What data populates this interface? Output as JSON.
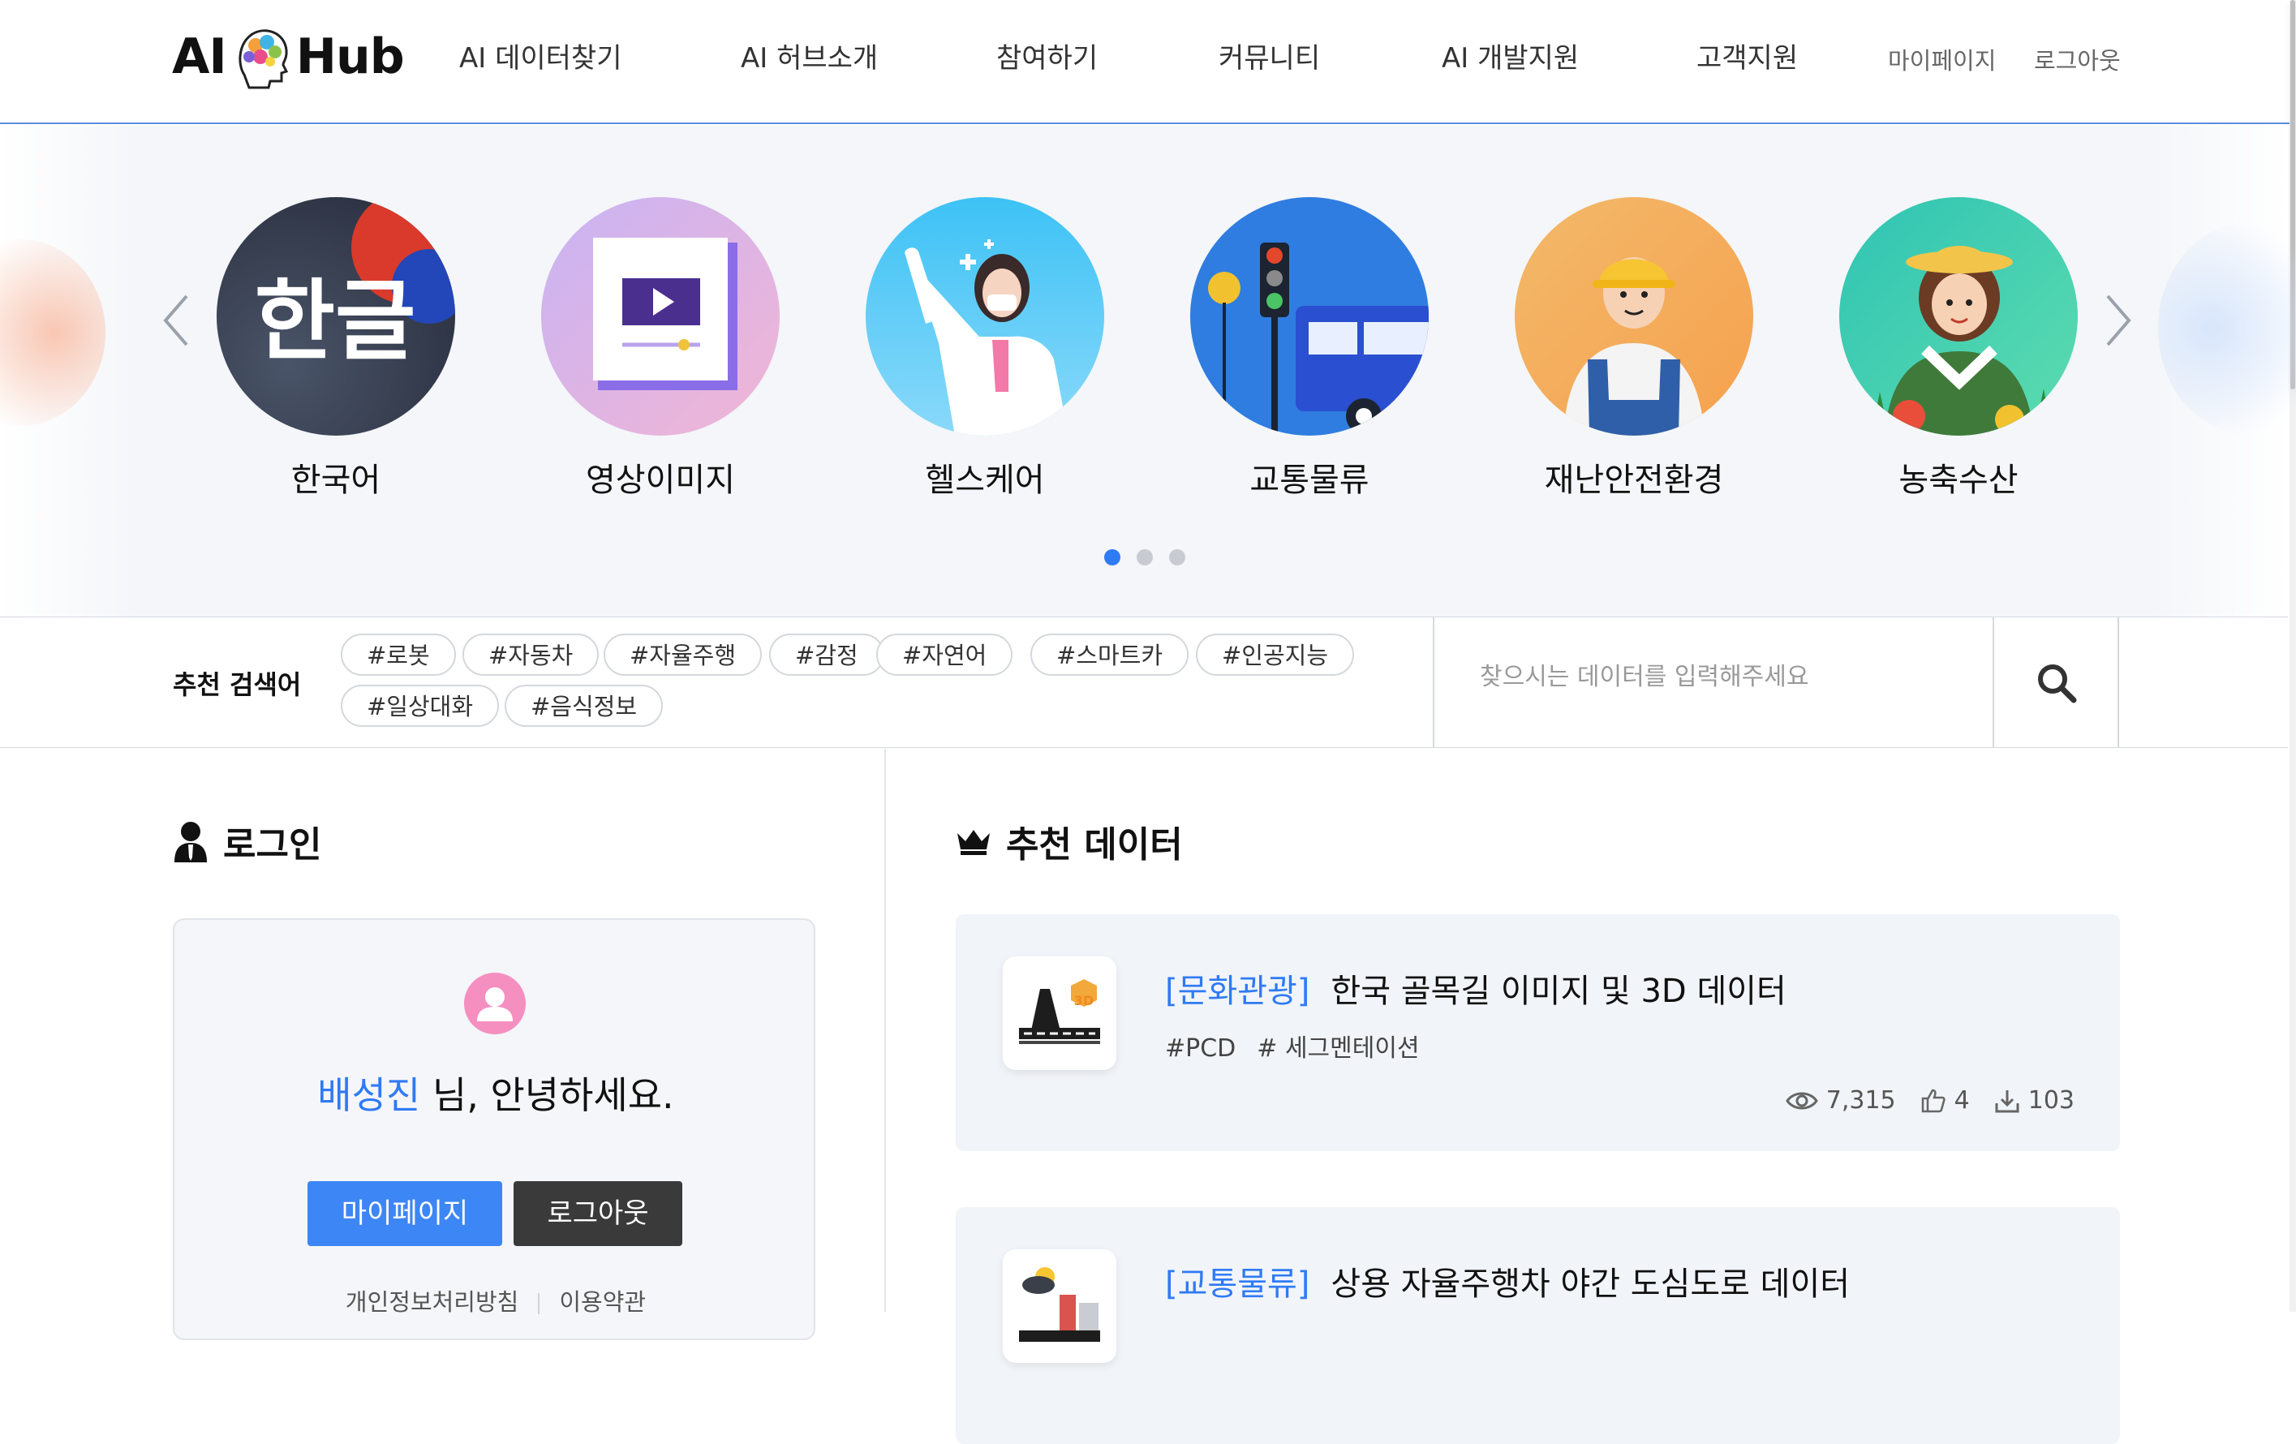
{
  "header": {
    "logo": {
      "left": "AI",
      "right": "Hub"
    },
    "nav": [
      "AI 데이터찾기",
      "AI 허브소개",
      "참여하기",
      "커뮤니티",
      "AI 개발지원",
      "고객지원"
    ],
    "sub_links": [
      "마이페이지",
      "로그아웃"
    ]
  },
  "carousel": {
    "categories": [
      "한국어",
      "영상이미지",
      "헬스케어",
      "교통물류",
      "재난안전환경",
      "농축수산"
    ],
    "icon_text_korean": "한글",
    "page_count": 3,
    "active_page": 1
  },
  "search": {
    "title": "추천 검색어",
    "tags": [
      "#로봇",
      "#자동차",
      "#자율주행",
      "#감정",
      "#자연어",
      "#스마트카",
      "#인공지능",
      "#일상대화",
      "#음식정보"
    ],
    "placeholder": "찾으시는 데이터를 입력해주세요"
  },
  "login": {
    "title": "로그인",
    "user_name": "배성진",
    "greeting_suffix": " 님, 안녕하세요.",
    "mypage_label": "마이페이지",
    "logout_label": "로그아웃",
    "links": [
      "개인정보처리방침",
      "이용약관"
    ]
  },
  "recommended": {
    "title": "추천 데이터",
    "items": [
      {
        "category": "[문화관광]",
        "title": "한국 골목길 이미지 및 3D 데이터",
        "tags": [
          "#PCD",
          "# 세그멘테이션"
        ],
        "views": "7,315",
        "likes": "4",
        "downloads": "103",
        "thumb_badge": "3D"
      },
      {
        "category": "[교통물류]",
        "title": "상용 자율주행차 야간 도심도로 데이터"
      }
    ]
  },
  "colors": {
    "accent": "#2f7af5",
    "dark_button": "#3a3a3a",
    "card_bg": "#f1f4f8"
  }
}
